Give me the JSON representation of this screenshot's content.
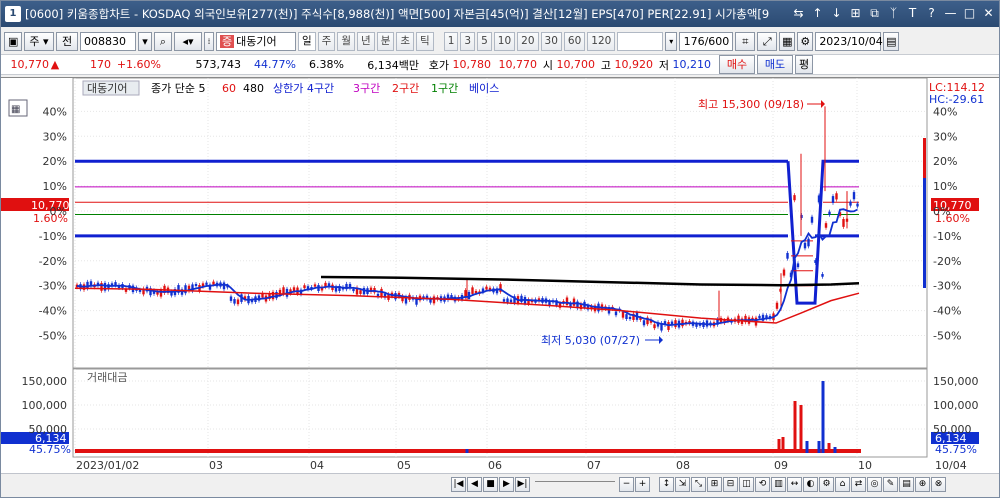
{
  "window": {
    "title": "[0600] 키움종합차트 - KOSDAQ 외국인보유[277(천)] 주식수[8,988(천)] 액면[500] 자본금[45(억)] 결산[12월] EPS[470] PER[22.91] 시가총액[9",
    "app_icon": "1"
  },
  "toolbar": {
    "type_label": "주",
    "market_label": "전",
    "code": "008830",
    "stock_name_tag": "증",
    "stock_name": "대동기어",
    "periods": [
      "일",
      "주",
      "월",
      "년",
      "분",
      "초",
      "틱"
    ],
    "active_period": "일",
    "minutes": [
      "1",
      "3",
      "5",
      "10",
      "20",
      "30",
      "60",
      "120"
    ],
    "count": "176/600",
    "date": "2023/10/04"
  },
  "quote": {
    "price": "10,770",
    "change": "170",
    "change_pct": "+1.60%",
    "volume": "573,743",
    "ratio": "44.77%",
    "rate2": "6.38%",
    "amount": "6,134백만",
    "ask_label": "호가",
    "ask": "10,780",
    "bid": "10,770",
    "open_label": "시",
    "open": "10,700",
    "high_label": "고",
    "high": "10,920",
    "low_label": "저",
    "low": "10,210",
    "buy_label": "매수",
    "sell_label": "매도",
    "eval_label": "평"
  },
  "legend": {
    "stock_name": "대동기어",
    "ma_text": "종가 단순 5",
    "ma60": "60",
    "ma480": "480",
    "upper_label": "상한가 4구간",
    "zone3": "3구간",
    "zone2": "2구간",
    "zone1": "1구간",
    "base": "베이스"
  },
  "price_axis": {
    "left_ticks": [
      "40%",
      "30%",
      "20%",
      "10%",
      "0%",
      "-10%",
      "-20%",
      "-30%",
      "-40%",
      "-50%"
    ],
    "right_ticks": [
      "40%",
      "30%",
      "20%",
      "10%",
      "0%",
      "-10%",
      "-20%",
      "-30%",
      "-40%",
      "-50%"
    ],
    "current_price": "10,770",
    "current_pct": "1.60%",
    "lc": "LC:114.12",
    "hc": "HC:-29.61"
  },
  "annotations": {
    "high": "최고 15,300 (09/18)",
    "low": "최저 5,030 (07/27)"
  },
  "volume_panel": {
    "title": "거래대금",
    "ticks": [
      "150,000",
      "100,000",
      "50,000"
    ],
    "current_value": "6,134",
    "current_pct": "45.75%"
  },
  "x_axis": {
    "labels": [
      "2023/01/02",
      "03",
      "04",
      "05",
      "06",
      "07",
      "08",
      "09",
      "10"
    ],
    "right_label": "10/04"
  },
  "colors": {
    "rise": "#e01010",
    "fall": "#1030d0",
    "ma60": "#e01010",
    "ma480": "#000000",
    "upper_zone": "#1020d0",
    "zone3": "#c000c0",
    "zone2": "#e01010",
    "zone1": "#008000",
    "base": "#1020d0"
  }
}
